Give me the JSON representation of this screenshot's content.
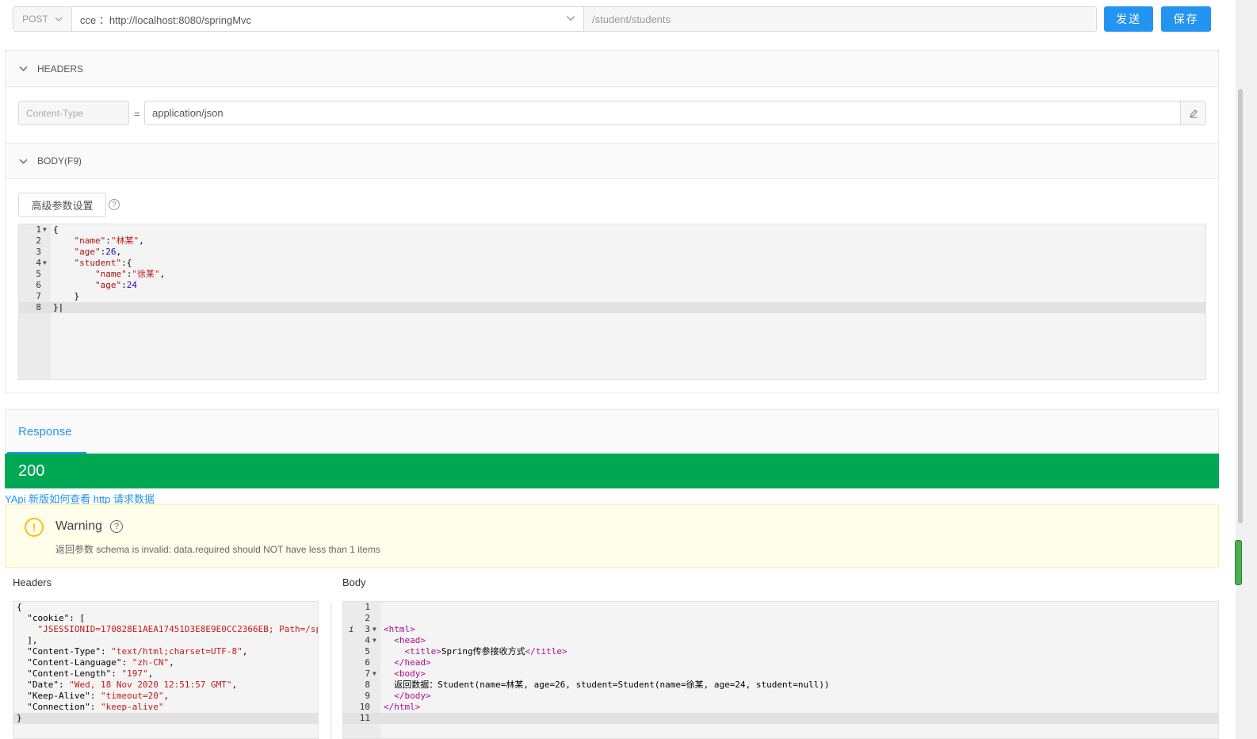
{
  "request": {
    "method": "POST",
    "env_value": "cce ：http://localhost:8080/springMvc",
    "path": "/student/students",
    "send_label": "发送",
    "save_label": "保存"
  },
  "headers_section": {
    "title": "HEADERS",
    "key_placeholder": "Content-Type",
    "equals": "=",
    "value": "application/json"
  },
  "body_section": {
    "title": "BODY(F9)",
    "advanced_label": "高级参数设置"
  },
  "response": {
    "tab_label": "Response",
    "status_code": "200",
    "help_link": "YApi 新版如何查看 http 请求数据",
    "warning_title": "Warning",
    "warning_message": "返回参数 schema is invalid: data.required should NOT have less than 1 items",
    "headers_label": "Headers",
    "body_label": "Body"
  },
  "colors": {
    "primary": "#2395f1",
    "success": "#00a854",
    "warning": "#ffbf00"
  },
  "icons": {
    "method_dropdown": "chevron-down-icon",
    "env_dropdown": "chevron-down-icon",
    "edit": "pencil-icon",
    "help": "question-circle-icon",
    "warning": "exclamation-circle-icon"
  }
}
